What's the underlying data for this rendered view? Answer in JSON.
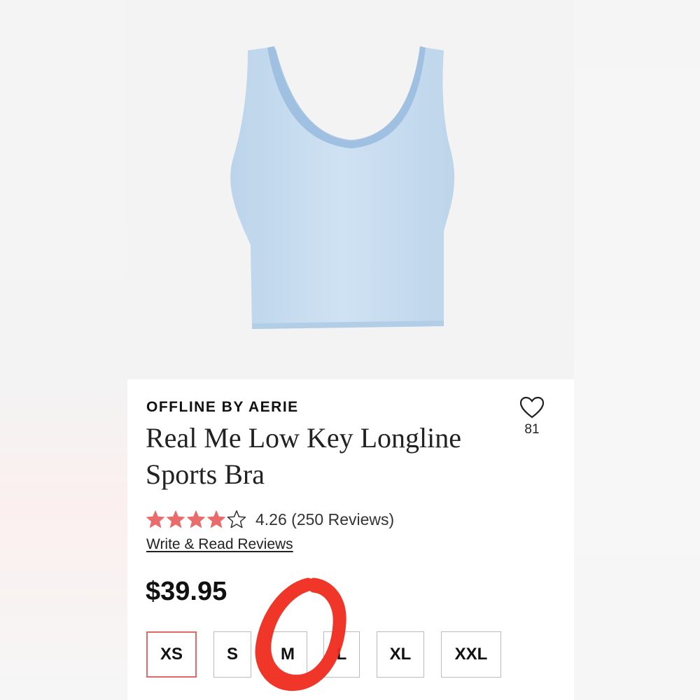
{
  "product": {
    "brand": "OFFLINE BY AERIE",
    "title": "Real Me Low Key Longline Sports Bra",
    "favorites_count": "81",
    "rating_value": 4.26,
    "rating_text": "4.26 (250 Reviews)",
    "reviews_link": "Write & Read Reviews",
    "price": "$39.95"
  },
  "sizes": [
    {
      "label": "XS",
      "selected": true
    },
    {
      "label": "S",
      "selected": false
    },
    {
      "label": "M",
      "selected": false
    },
    {
      "label": "L",
      "selected": false
    },
    {
      "label": "XL",
      "selected": false
    },
    {
      "label": "XXL",
      "selected": false
    }
  ],
  "icons": {
    "favorite": "heart-outline-icon",
    "rating": "star-icon"
  },
  "colors": {
    "product_color": "#c9def0",
    "star_fill": "#e96b6b",
    "selected_border": "#e06a6a",
    "annotation": "#ee2b1c"
  }
}
